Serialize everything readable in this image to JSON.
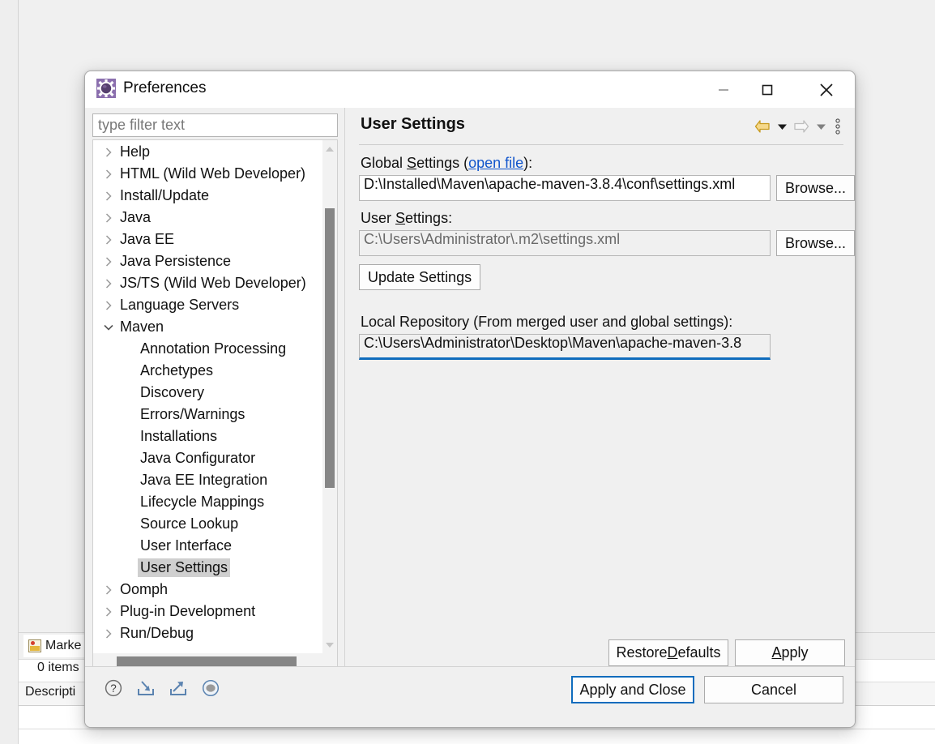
{
  "workbench": {
    "markers_tab_label": "Marke",
    "markers_count": "0 items",
    "markers_column_description": "Descripti"
  },
  "dialog": {
    "title": "Preferences",
    "icon": "preferences-gear-icon",
    "window_controls": {
      "minimize": "minimize-icon",
      "maximize": "maximize-icon",
      "close": "close-icon"
    }
  },
  "filter": {
    "placeholder": "type filter text",
    "value": ""
  },
  "tree": {
    "items": [
      {
        "label": "Help",
        "indent": 0,
        "state": "collapsed",
        "selected": false
      },
      {
        "label": "HTML (Wild Web Developer)",
        "indent": 0,
        "state": "collapsed",
        "selected": false
      },
      {
        "label": "Install/Update",
        "indent": 0,
        "state": "collapsed",
        "selected": false
      },
      {
        "label": "Java",
        "indent": 0,
        "state": "collapsed",
        "selected": false
      },
      {
        "label": "Java EE",
        "indent": 0,
        "state": "collapsed",
        "selected": false
      },
      {
        "label": "Java Persistence",
        "indent": 0,
        "state": "collapsed",
        "selected": false
      },
      {
        "label": "JS/TS (Wild Web Developer)",
        "indent": 0,
        "state": "collapsed",
        "selected": false
      },
      {
        "label": "Language Servers",
        "indent": 0,
        "state": "collapsed",
        "selected": false
      },
      {
        "label": "Maven",
        "indent": 0,
        "state": "expanded",
        "selected": false
      },
      {
        "label": "Annotation Processing",
        "indent": 1,
        "state": "leaf",
        "selected": false
      },
      {
        "label": "Archetypes",
        "indent": 1,
        "state": "leaf",
        "selected": false
      },
      {
        "label": "Discovery",
        "indent": 1,
        "state": "leaf",
        "selected": false
      },
      {
        "label": "Errors/Warnings",
        "indent": 1,
        "state": "leaf",
        "selected": false
      },
      {
        "label": "Installations",
        "indent": 1,
        "state": "leaf",
        "selected": false
      },
      {
        "label": "Java Configurator",
        "indent": 1,
        "state": "leaf",
        "selected": false
      },
      {
        "label": "Java EE Integration",
        "indent": 1,
        "state": "leaf",
        "selected": false
      },
      {
        "label": "Lifecycle Mappings",
        "indent": 1,
        "state": "leaf",
        "selected": false
      },
      {
        "label": "Source Lookup",
        "indent": 1,
        "state": "leaf",
        "selected": false
      },
      {
        "label": "User Interface",
        "indent": 1,
        "state": "leaf",
        "selected": false
      },
      {
        "label": "User Settings",
        "indent": 1,
        "state": "leaf",
        "selected": true
      },
      {
        "label": "Oomph",
        "indent": 0,
        "state": "collapsed",
        "selected": false
      },
      {
        "label": "Plug-in Development",
        "indent": 0,
        "state": "collapsed",
        "selected": false
      },
      {
        "label": "Run/Debug",
        "indent": 0,
        "state": "collapsed",
        "selected": false
      }
    ]
  },
  "page": {
    "title": "User Settings",
    "nav": {
      "back": "back-arrow-icon",
      "back_menu": "back-dropdown-icon",
      "forward": "forward-arrow-icon",
      "forward_menu": "forward-dropdown-icon",
      "view_menu": "view-menu-icon"
    },
    "global_settings": {
      "label_prefix": "Global ",
      "label_mnemonic": "S",
      "label_suffix": "ettings (",
      "link_text": "open file",
      "label_end": "):",
      "value": "D:\\Installed\\Maven\\apache-maven-3.8.4\\conf\\settings.xml",
      "browse_label": "Browse..."
    },
    "user_settings": {
      "label_prefix": "User ",
      "label_mnemonic": "S",
      "label_suffix": "ettings:",
      "value": "C:\\Users\\Administrator\\.m2\\settings.xml",
      "browse_label": "Browse..."
    },
    "update_settings_label": "Update Settings",
    "local_repository": {
      "label": "Local Repository (From merged user and global settings):",
      "value": "C:\\Users\\Administrator\\Desktop\\Maven\\apache-maven-3.8"
    },
    "restore_defaults": {
      "prefix": "Restore ",
      "mnemonic": "D",
      "suffix": "efaults"
    },
    "apply": {
      "prefix": "",
      "mnemonic": "A",
      "suffix": "pply"
    }
  },
  "footer": {
    "icons": [
      {
        "name": "help-icon"
      },
      {
        "name": "import-preferences-icon"
      },
      {
        "name": "export-preferences-icon"
      },
      {
        "name": "record-preferences-icon"
      }
    ],
    "apply_and_close_label": "Apply and Close",
    "cancel_label": "Cancel"
  },
  "colors": {
    "accent": "#0f6cbd",
    "link": "#1155cc",
    "selection": "#cfcfcf",
    "nav_back": "#d9a32a"
  }
}
